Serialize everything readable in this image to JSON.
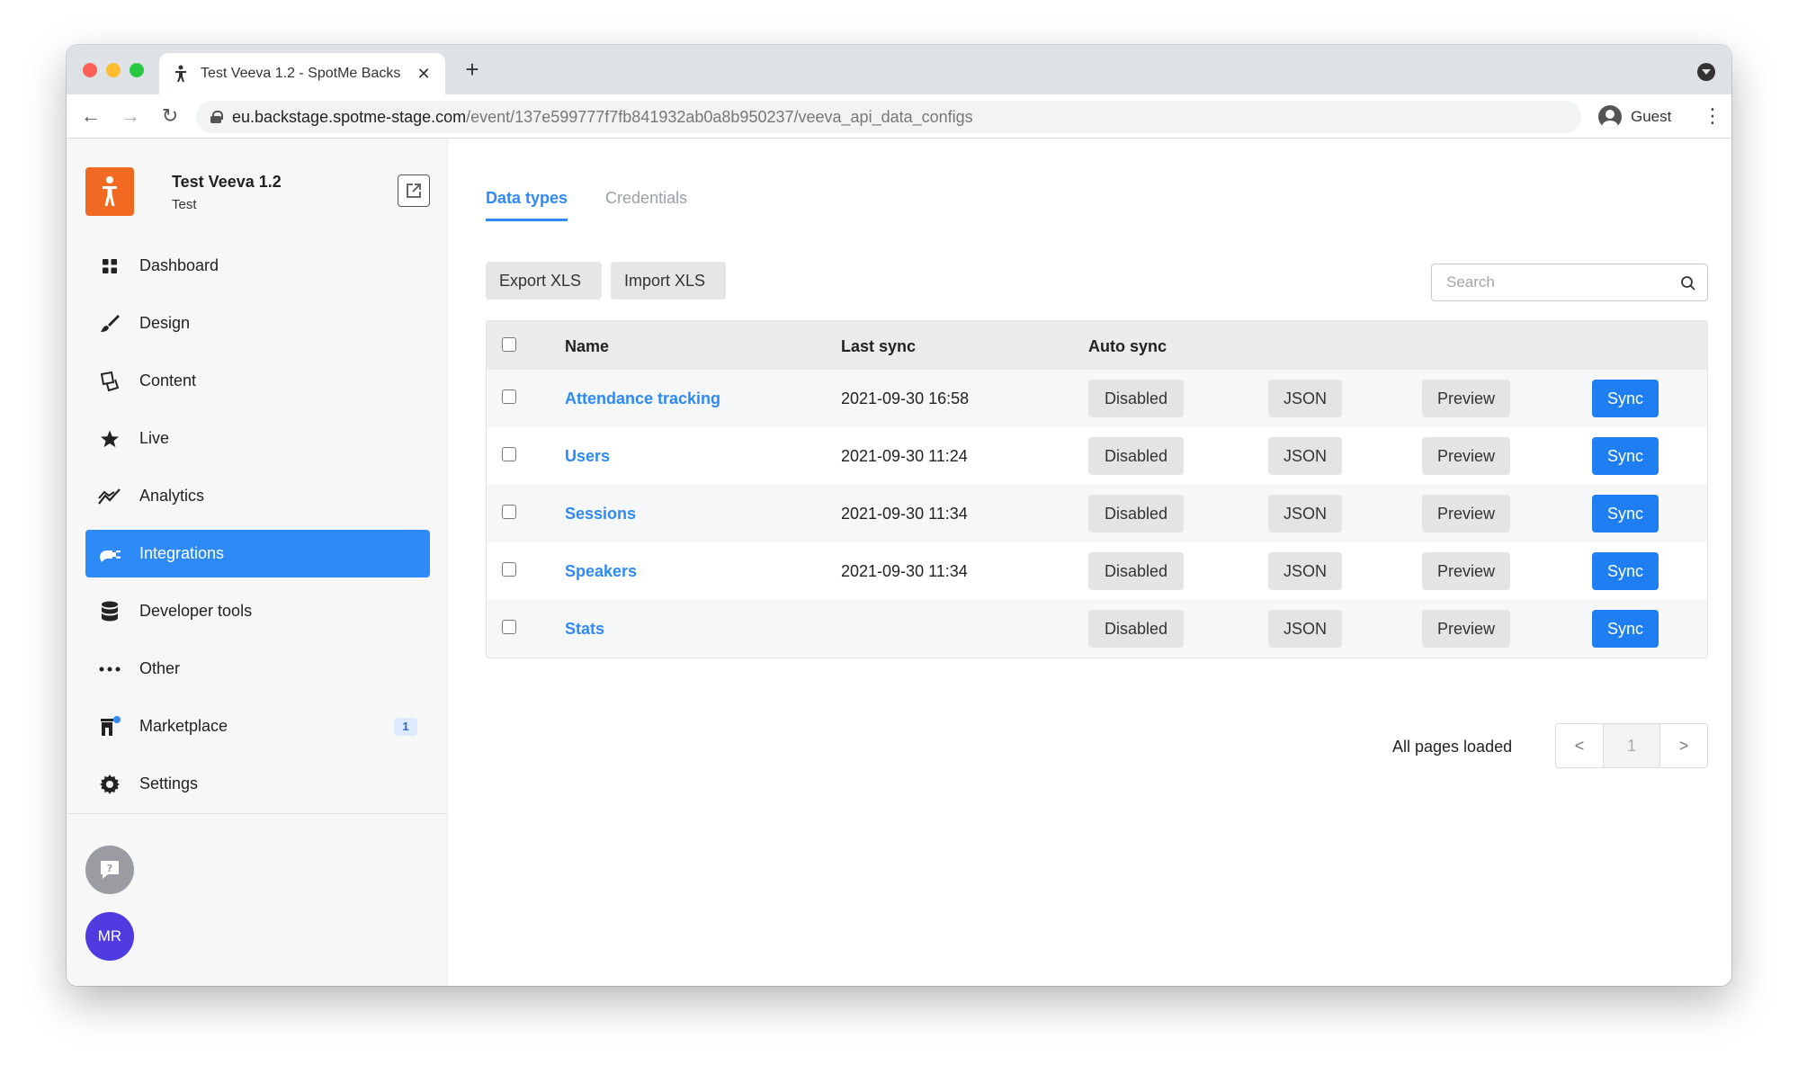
{
  "browser": {
    "tab_title": "Test Veeva 1.2 - SpotMe Backs",
    "tab_close": "✕",
    "new_tab": "+",
    "url_host": "eu.backstage.spotme-stage.com",
    "url_path": "/event/137e599777f7fb841932ab0a8b950237/veeva_api_data_configs",
    "guest_label": "Guest",
    "back_glyph": "←",
    "forward_glyph": "→",
    "reload_glyph": "↻",
    "menu_glyph": "⋮"
  },
  "event": {
    "title": "Test Veeva 1.2",
    "subtitle": "Test"
  },
  "sidebar": {
    "items": [
      {
        "label": "Dashboard",
        "icon": "grid-icon"
      },
      {
        "label": "Design",
        "icon": "brush-icon"
      },
      {
        "label": "Content",
        "icon": "content-icon"
      },
      {
        "label": "Live",
        "icon": "star-icon"
      },
      {
        "label": "Analytics",
        "icon": "chart-line-icon"
      },
      {
        "label": "Integrations",
        "icon": "plug-icon",
        "active": true
      },
      {
        "label": "Developer tools",
        "icon": "database-icon"
      },
      {
        "label": "Other",
        "icon": "more-icon"
      },
      {
        "label": "Marketplace",
        "icon": "store-icon",
        "badge": "1"
      },
      {
        "label": "Settings",
        "icon": "gear-icon"
      }
    ],
    "user_initials": "MR"
  },
  "main": {
    "tabs": [
      {
        "label": "Data types",
        "active": true
      },
      {
        "label": "Credentials",
        "active": false
      }
    ],
    "export_label": "Export XLS",
    "import_label": "Import XLS",
    "search_placeholder": "Search",
    "table": {
      "headers": {
        "name": "Name",
        "last_sync": "Last sync",
        "auto_sync": "Auto sync"
      },
      "rows": [
        {
          "name": "Attendance tracking",
          "last_sync": "2021-09-30 16:58",
          "auto": "Disabled",
          "json": "JSON",
          "preview": "Preview",
          "sync": "Sync"
        },
        {
          "name": "Users",
          "last_sync": "2021-09-30 11:24",
          "auto": "Disabled",
          "json": "JSON",
          "preview": "Preview",
          "sync": "Sync"
        },
        {
          "name": "Sessions",
          "last_sync": "2021-09-30 11:34",
          "auto": "Disabled",
          "json": "JSON",
          "preview": "Preview",
          "sync": "Sync"
        },
        {
          "name": "Speakers",
          "last_sync": "2021-09-30 11:34",
          "auto": "Disabled",
          "json": "JSON",
          "preview": "Preview",
          "sync": "Sync"
        },
        {
          "name": "Stats",
          "last_sync": "",
          "auto": "Disabled",
          "json": "JSON",
          "preview": "Preview",
          "sync": "Sync"
        }
      ]
    },
    "pager": {
      "status": "All pages loaded",
      "prev": "<",
      "page": "1",
      "next": ">"
    }
  },
  "colors": {
    "accent": "#2d8af6",
    "sync_button": "#1f7ef2",
    "brand_logo": "#f26a22",
    "avatar": "#4f3be0"
  }
}
